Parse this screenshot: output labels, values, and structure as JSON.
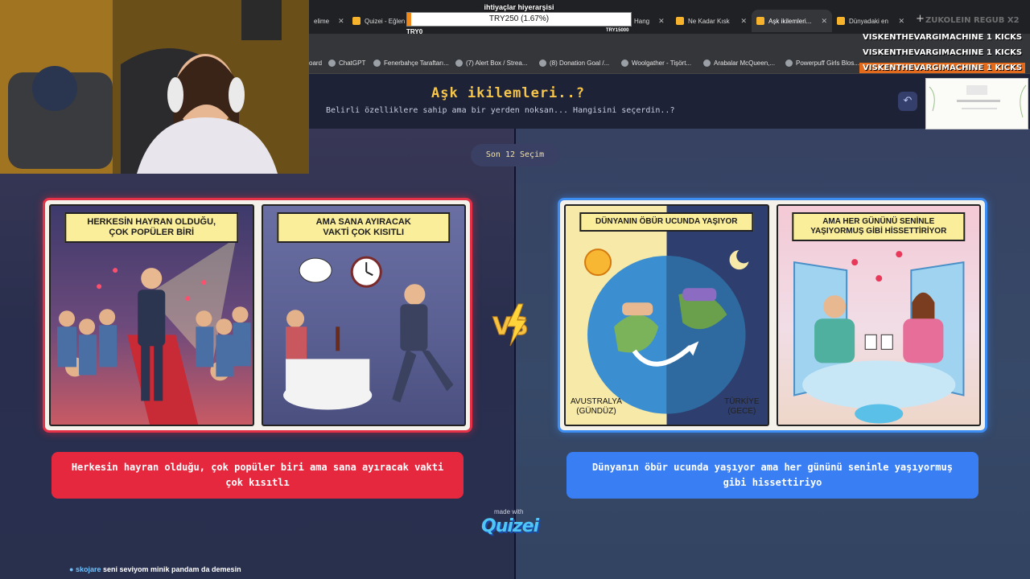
{
  "browser": {
    "tabs": [
      {
        "label": "elime"
      },
      {
        "label": "Quizei - Eğlen"
      },
      {
        "label": "Hang"
      },
      {
        "label": "Ne Kadar Kısk"
      },
      {
        "label": "Aşk ikilemleri..."
      },
      {
        "label": "Dünyadaki en"
      }
    ],
    "bookmarks": [
      {
        "label": "oard"
      },
      {
        "label": "ChatGPT"
      },
      {
        "label": "Fenerbahçe Taraftarı..."
      },
      {
        "label": "(7) Alert Box / Strea..."
      },
      {
        "label": "(8) Donation Goal /..."
      },
      {
        "label": "Woolgather - Tişört..."
      },
      {
        "label": "Arabalar McQueen,..."
      },
      {
        "label": "Powerpuff Girls Blos..."
      }
    ]
  },
  "quiz": {
    "title": "Aşk ikilemleri..?",
    "subtitle": "Belirli özelliklere sahip ama bir yerden noksan... Hangisini seçerdin..?",
    "history_button": "Son 12 Seçim",
    "left": {
      "panel1_caption": "HERKESİN HAYRAN OLDUĞU,\nÇOK POPÜLER BİRİ",
      "panel2_caption": "AMA SANA AYIRACAK\nVAKTİ ÇOK KISITLI",
      "answer": "Herkesin hayran olduğu, çok popüler biri ama sana ayıracak vakti çok kısıtlı"
    },
    "right": {
      "panel1_caption": "DÜNYANIN ÖBÜR UCUNDA YAŞIYOR",
      "panel1_label_left": "AVUSTRALYA\n(GÜNDÜZ)",
      "panel1_label_right": "TÜRKİYE\n(GECE)",
      "panel2_caption": "AMA HER GÜNÜNÜ SENİNLE\nYAŞIYORMUŞ GİBİ HİSSETTİRİYOR",
      "answer": "Dünyanın öbür ucunda yaşıyor ama her gününü seninle yaşıyormuş gibi hissettiriyo"
    },
    "vs_icon": "vs-lightning-icon",
    "made_with": "made with",
    "brand": "Quizei"
  },
  "overlay": {
    "donation": {
      "title": "ihtiyaçlar hiyerarşisi",
      "progress_text": "TRY250 (1.67%)",
      "progress_fraction": 0.0167,
      "min": "TRY0",
      "max": "TRY15000"
    },
    "kicks": [
      {
        "text": "VISKENTHEVARGIMACHINE 1 KICKS"
      },
      {
        "text": "VISKENTHEVARGIMACHINE 1 KICKS"
      },
      {
        "text": "VISKENTHEVARGIMACHINE 1 KICKS"
      }
    ],
    "kicks_faint": "ZUKOLEIN REGUB X2",
    "chat": {
      "user": "skojare",
      "message": "seni seviyom minik pandam da demesin"
    },
    "colors": {
      "accent_orange": "#e26a1c",
      "red": "#e6283f",
      "blue": "#3a7ef3",
      "gold": "#f6c549"
    }
  }
}
